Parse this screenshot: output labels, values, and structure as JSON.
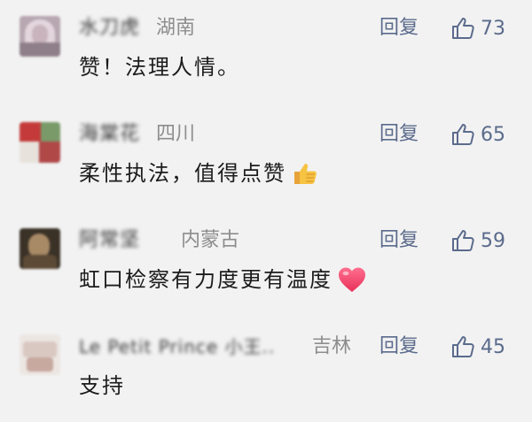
{
  "comments": [
    {
      "nickname": "水刀虎",
      "region": "湖南",
      "reply_label": "回复",
      "like_count": "73",
      "text": "赞！法理人情。",
      "emoji": ""
    },
    {
      "nickname": "海棠花",
      "region": "四川",
      "reply_label": "回复",
      "like_count": "65",
      "text": "柔性执法，值得点赞",
      "emoji": "thumbs-up-emoji"
    },
    {
      "nickname": "阿常坚",
      "region": "内蒙古",
      "reply_label": "回复",
      "like_count": "59",
      "text": "虹口检察有力度更有温度",
      "emoji": "heart-emoji"
    },
    {
      "nickname": "Le Petit Prince 小王..",
      "region": "吉林",
      "reply_label": "回复",
      "like_count": "45",
      "text": "支持",
      "emoji": ""
    }
  ],
  "colors": {
    "background": "#f2f2f2",
    "action": "#5b6b8c",
    "region": "#8d8d8d",
    "text": "#1c1c1c"
  },
  "icons": {
    "like": "thumbs-up-outline-icon"
  }
}
